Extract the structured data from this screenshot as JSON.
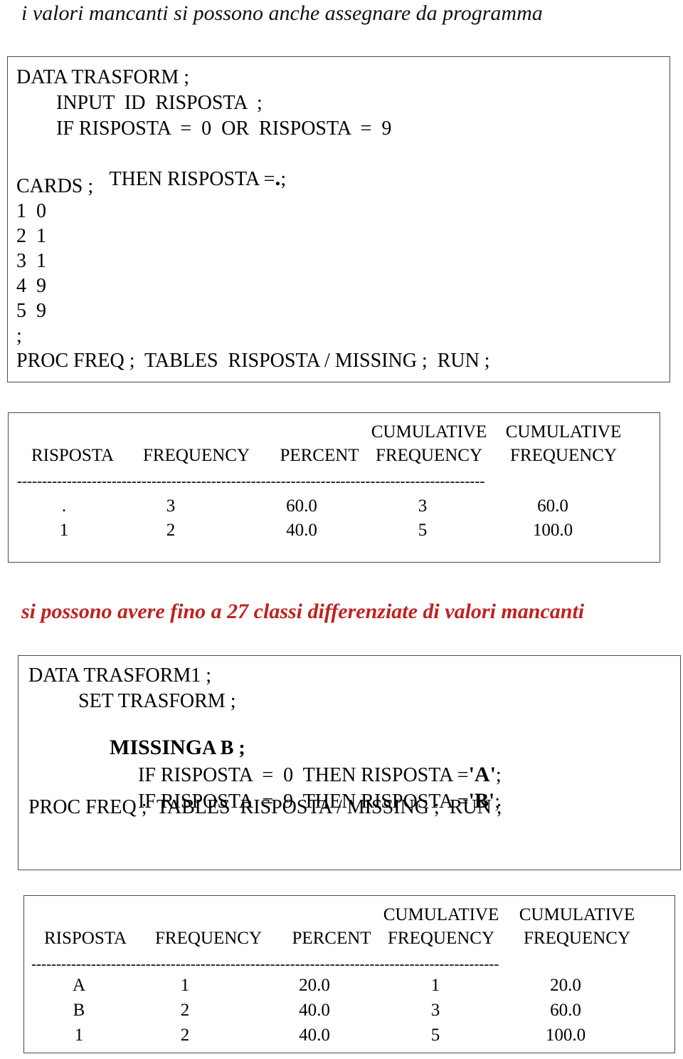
{
  "headings": {
    "main": "i valori mancanti si possono anche assegnare da programma",
    "middle": "si possono avere fino a 27 classi differenziate di valori mancanti",
    "middle_color": "#C0211F"
  },
  "code_block_1": {
    "lines": [
      "DATA TRASFORM ;",
      "INPUT  ID  RISPOSTA  ;",
      "IF RISPOSTA  =  0  OR  RISPOSTA  =  9",
      "THEN RISPOSTA =",
      ". ;",
      "CARDS ;",
      "1  0",
      "2  1",
      "3  1",
      "4  9",
      "5  9",
      ";",
      "PROC FREQ ;  TABLES  RISPOSTA / MISSING ;  RUN ;"
    ],
    "l1": "DATA TRASFORM ;",
    "l2": "INPUT  ID  RISPOSTA  ;",
    "l3": "IF RISPOSTA  =  0  OR  RISPOSTA  =  9",
    "l4a": "THEN RISPOSTA =",
    "l4b": ".",
    "l4c": ";",
    "l5": "CARDS ;",
    "l6": "1  0",
    "l7": "2  1",
    "l8": "3  1",
    "l9": "4  9",
    "l10": "5  9",
    "l11": ";",
    "l12": "PROC FREQ ;  TABLES  RISPOSTA / MISSING ;  RUN ;"
  },
  "code_block_2": {
    "l1": "DATA TRASFORM1 ;",
    "l2": "SET TRASFORM ;",
    "l3a": "MISSING",
    "l3b": "A B ;",
    "l4a": "IF RISPOSTA  =  0  THEN RISPOSTA =",
    "l4b": "'A'",
    "l4c": ";",
    "l5a": "IF RISPOSTA  =  9  THEN RISPOSTA =",
    "l5b": "'B'",
    "l5c": ";",
    "l6": "PROC FREQ ;  TABLES  RISPOSTA / MISSING ;  RUN ;"
  },
  "table_1": {
    "header_top": [
      "",
      "",
      "",
      "CUMULATIVE",
      "CUMULATIVE"
    ],
    "headers": [
      "RISPOSTA",
      "FREQUENCY",
      "PERCENT",
      "FREQUENCY",
      "FREQUENCY"
    ],
    "rule": "----------------------------------------------------------------------------------------------",
    "rows": [
      [
        ".",
        "3",
        "60.0",
        "3",
        "60.0"
      ],
      [
        "1",
        "2",
        "40.0",
        "5",
        "100.0"
      ]
    ]
  },
  "table_2": {
    "header_top": [
      "",
      "",
      "",
      "CUMULATIVE",
      "CUMULATIVE"
    ],
    "headers": [
      "RISPOSTA",
      "FREQUENCY",
      "PERCENT",
      "FREQUENCY",
      "FREQUENCY"
    ],
    "rule": "----------------------------------------------------------------------------------------------",
    "rows": [
      [
        "A",
        "1",
        "20.0",
        "1",
        "20.0"
      ],
      [
        "B",
        "2",
        "40.0",
        "3",
        "60.0"
      ],
      [
        "1",
        "2",
        "40.0",
        "5",
        "100.0"
      ]
    ]
  }
}
